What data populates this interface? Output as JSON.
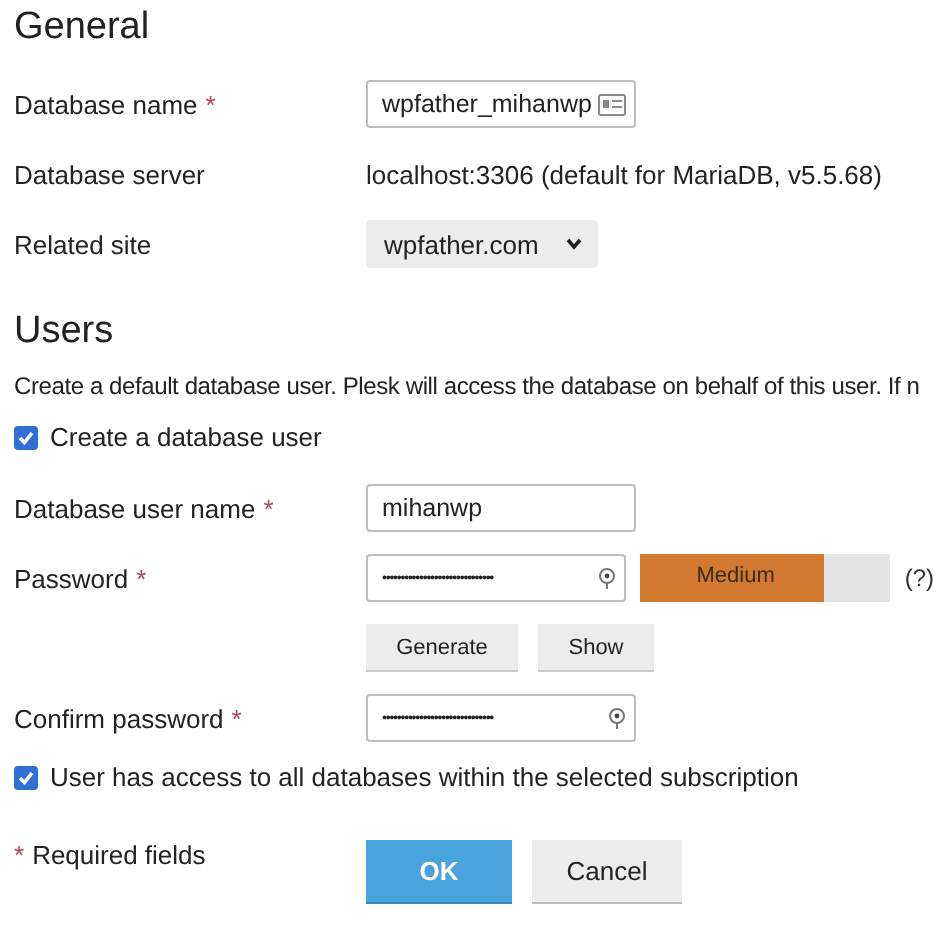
{
  "general": {
    "heading": "General",
    "database_name": {
      "label": "Database name",
      "required_mark": "*",
      "value": "wpfather_mihanwp"
    },
    "database_server": {
      "label": "Database server",
      "value": "localhost:3306 (default for MariaDB, v5.5.68)"
    },
    "related_site": {
      "label": "Related site",
      "value": "wpfather.com"
    }
  },
  "users": {
    "heading": "Users",
    "description": "Create a default database user. Plesk will access the database on behalf of this user. If n",
    "create_user": {
      "label": "Create a database user",
      "checked": true
    },
    "user_name": {
      "label": "Database user name",
      "required_mark": "*",
      "value": "mihanwp"
    },
    "password": {
      "label": "Password",
      "required_mark": "*",
      "value": "••••••••••••••••••••••••••••••",
      "strength": {
        "label": "Medium",
        "level": 0.73
      },
      "help": "(?)"
    },
    "password_buttons": [
      "Generate",
      "Show"
    ],
    "confirm_password": {
      "label": "Confirm password",
      "required_mark": "*",
      "value": "••••••••••••••••••••••••••••••"
    },
    "all_databases": {
      "label": "User has access to all databases within the selected subscription",
      "checked": true
    }
  },
  "footer": {
    "required_mark": "*",
    "required_note": "Required fields",
    "buttons": [
      {
        "label": "OK",
        "kind": "primary"
      },
      {
        "label": "Cancel",
        "kind": "secondary"
      }
    ]
  }
}
